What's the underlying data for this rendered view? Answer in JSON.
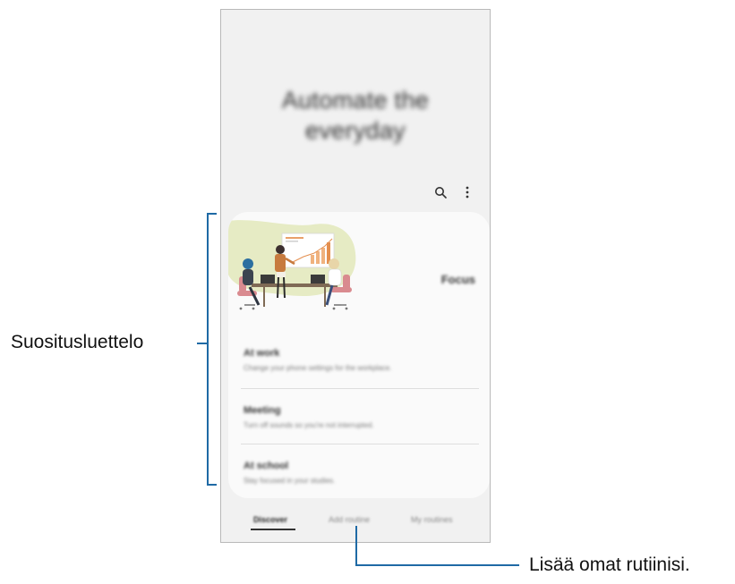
{
  "screen": {
    "hero_title_line1": "Automate the",
    "hero_title_line2": "everyday",
    "toolbar": {
      "search_icon": "search-icon",
      "more_icon": "more-options-icon"
    },
    "card": {
      "focus_label": "Focus",
      "routines": [
        {
          "title": "At work",
          "description": "Change your phone settings for the workplace."
        },
        {
          "title": "Meeting",
          "description": "Turn off sounds so you're not interrupted."
        },
        {
          "title": "At school",
          "description": "Stay focused in your studies."
        }
      ]
    },
    "tabs": [
      {
        "label": "Discover",
        "selected": true
      },
      {
        "label": "Add routine",
        "selected": false
      },
      {
        "label": "My routines",
        "selected": false
      }
    ]
  },
  "callouts": {
    "left_label": "Suositusluettelo",
    "bottom_label": "Lisää omat rutiinisi."
  },
  "colors": {
    "callout_line": "#1f6aa5",
    "screen_bg": "#f1f1f1",
    "card_bg": "#fafafa"
  }
}
